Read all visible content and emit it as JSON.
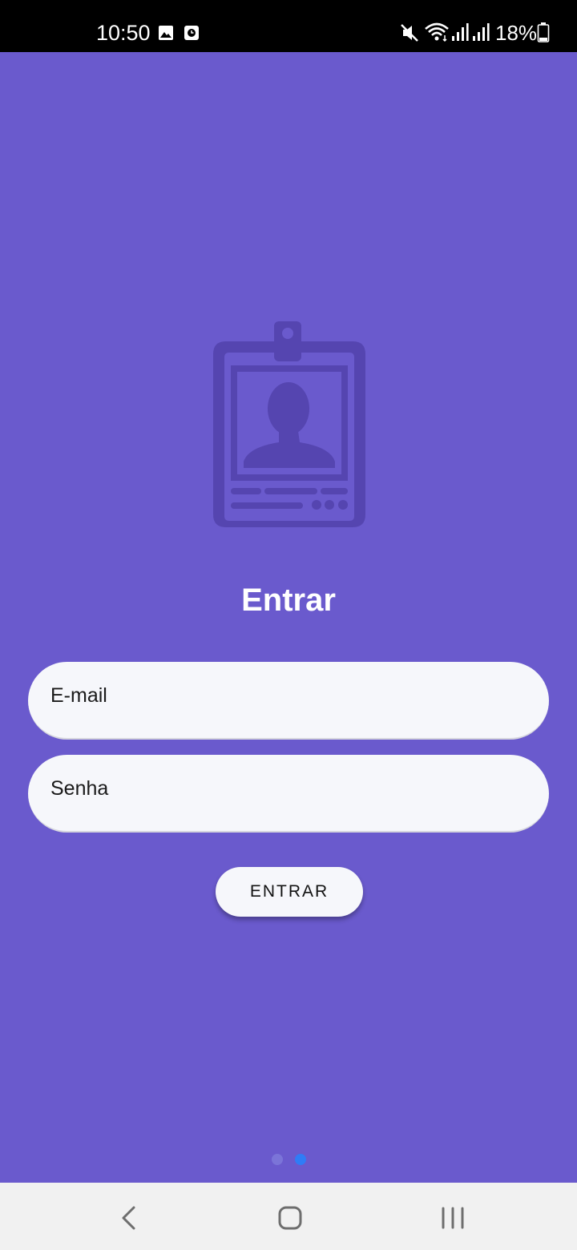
{
  "status_bar": {
    "time": "10:50",
    "battery_percent": "18%",
    "icons": [
      "image-icon",
      "clock-notification-icon",
      "mute-icon",
      "wifi-icon",
      "signal-icon",
      "signal-icon",
      "battery-icon"
    ]
  },
  "login": {
    "title": "Entrar",
    "email_placeholder": "E-mail",
    "password_placeholder": "Senha",
    "submit_label": "ENTRAR"
  },
  "page_indicator": {
    "count": 2,
    "active_index": 1
  },
  "colors": {
    "background": "#6a5acd",
    "icon": "#5545b0",
    "field": "#f6f7fb",
    "active_dot": "#2f7cf6",
    "inactive_dot": "#7b74d8"
  },
  "nav_bar": {
    "icons": [
      "back-icon",
      "home-icon",
      "recent-apps-icon"
    ]
  }
}
